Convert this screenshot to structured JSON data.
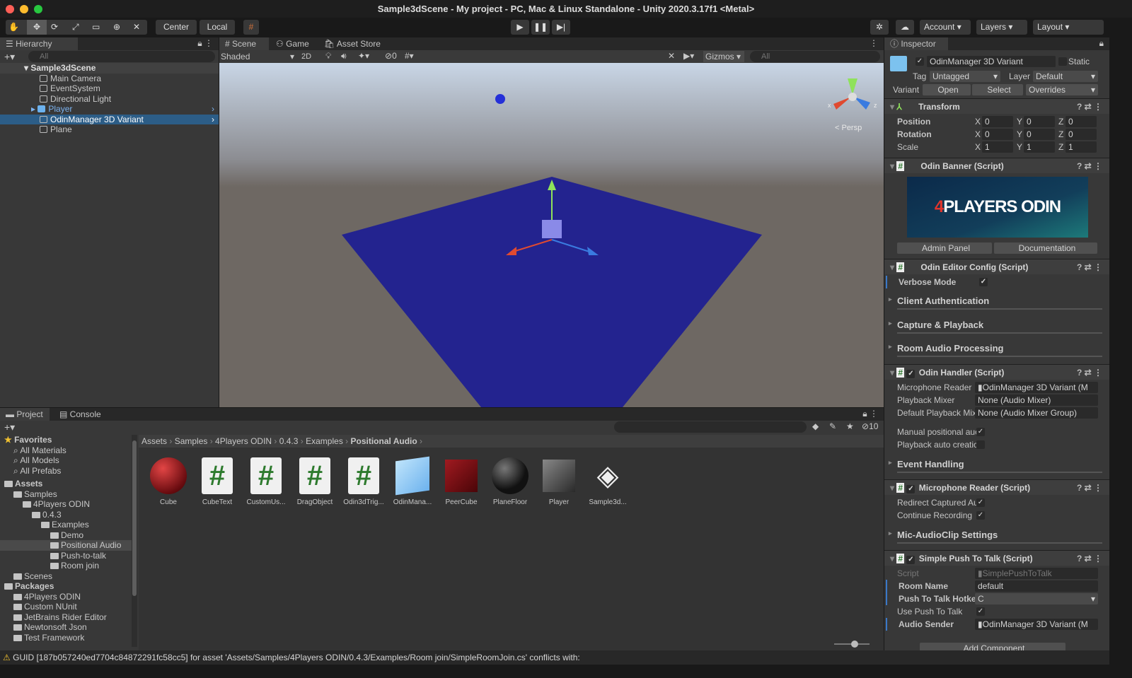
{
  "window": {
    "title": "Sample3dScene - My project - PC, Mac & Linux Standalone - Unity 2020.3.17f1 <Metal>"
  },
  "toolbar": {
    "tools": [
      "hand-tool",
      "move-tool",
      "rotate-tool",
      "scale-tool",
      "rect-tool",
      "transform-tool",
      "custom-tool"
    ],
    "pivot": "Center",
    "space": "Local",
    "account": "Account",
    "layers": "Layers",
    "layout": "Layout"
  },
  "hierarchy": {
    "tab": "Hierarchy",
    "search_placeholder": "All",
    "scene": "Sample3dScene",
    "items": [
      {
        "label": "Main Camera"
      },
      {
        "label": "EventSystem"
      },
      {
        "label": "Directional Light"
      },
      {
        "label": "Player"
      },
      {
        "label": "OdinManager 3D Variant"
      },
      {
        "label": "Plane"
      }
    ]
  },
  "scene": {
    "tabs": [
      "Scene",
      "Game",
      "Asset Store"
    ],
    "shading": "Shaded",
    "mode_2d": "2D",
    "hidden_count": "0",
    "gizmos": "Gizmos",
    "search_placeholder": "All",
    "persp": "< Persp",
    "axis_x": "x",
    "axis_z": "z",
    "colors": {
      "plane": "#23238f",
      "ground": "#6e6863",
      "sky": "#c9d6e6"
    }
  },
  "project": {
    "tabs": [
      "Project",
      "Console"
    ],
    "hidden_count": "10",
    "breadcrumb": [
      "Assets",
      "Samples",
      "4Players ODIN",
      "0.4.3",
      "Examples",
      "Positional Audio"
    ],
    "tree": [
      {
        "label": "Favorites",
        "depth": 0,
        "bold": true
      },
      {
        "label": "All Materials",
        "depth": 1
      },
      {
        "label": "All Models",
        "depth": 1
      },
      {
        "label": "All Prefabs",
        "depth": 1
      },
      {
        "label": "Assets",
        "depth": 0,
        "bold": true
      },
      {
        "label": "Samples",
        "depth": 1
      },
      {
        "label": "4Players ODIN",
        "depth": 2
      },
      {
        "label": "0.4.3",
        "depth": 3
      },
      {
        "label": "Examples",
        "depth": 4
      },
      {
        "label": "Demo",
        "depth": 5
      },
      {
        "label": "Positional Audio",
        "depth": 5
      },
      {
        "label": "Push-to-talk",
        "depth": 5
      },
      {
        "label": "Room join",
        "depth": 5
      },
      {
        "label": "Scenes",
        "depth": 1
      },
      {
        "label": "Packages",
        "depth": 0,
        "bold": true
      },
      {
        "label": "4Players ODIN",
        "depth": 1
      },
      {
        "label": "Custom NUnit",
        "depth": 1
      },
      {
        "label": "JetBrains Rider Editor",
        "depth": 1
      },
      {
        "label": "Newtonsoft Json",
        "depth": 1
      },
      {
        "label": "Test Framework",
        "depth": 1
      }
    ],
    "assets": [
      {
        "label": "Cube",
        "kind": "sphere-red"
      },
      {
        "label": "CubeText",
        "kind": "script"
      },
      {
        "label": "CustomUs...",
        "kind": "script"
      },
      {
        "label": "DragObject",
        "kind": "script"
      },
      {
        "label": "Odin3dTrig...",
        "kind": "script"
      },
      {
        "label": "OdinMana...",
        "kind": "prefab-variant"
      },
      {
        "label": "PeerCube",
        "kind": "cube-red"
      },
      {
        "label": "PlaneFloor",
        "kind": "sphere-black"
      },
      {
        "label": "Player",
        "kind": "cube-gray"
      },
      {
        "label": "Sample3d...",
        "kind": "unity-scene"
      }
    ]
  },
  "inspector": {
    "tab": "Inspector",
    "object_name": "OdinManager 3D Variant",
    "static": "Static",
    "tag_label": "Tag",
    "tag": "Untagged",
    "layer_label": "Layer",
    "layer": "Default",
    "variant_label": "Variant",
    "open": "Open",
    "select": "Select",
    "overrides": "Overrides",
    "transform": {
      "title": "Transform",
      "rows": [
        {
          "label": "Position",
          "x": "0",
          "y": "0",
          "z": "0"
        },
        {
          "label": "Rotation",
          "x": "0",
          "y": "0",
          "z": "0"
        },
        {
          "label": "Scale",
          "x": "1",
          "y": "1",
          "z": "1"
        }
      ]
    },
    "banner": {
      "title": "Odin Banner (Script)",
      "logo": "4PLAYERS ODIN",
      "admin": "Admin Panel",
      "docs": "Documentation"
    },
    "config": {
      "title": "Odin Editor Config (Script)",
      "verbose": "Verbose Mode",
      "sections": [
        "Client Authentication",
        "Capture & Playback",
        "Room Audio Processing"
      ]
    },
    "handler": {
      "title": "Odin Handler (Script)",
      "mic_label": "Microphone Reader",
      "mic": "OdinManager 3D Variant (M",
      "mixer_label": "Playback Mixer",
      "mixer": "None (Audio Mixer)",
      "group_label": "Default Playback Mix",
      "group": "None (Audio Mixer Group)",
      "manual": "Manual positional auc",
      "auto": "Playback auto creatic",
      "events": "Event Handling"
    },
    "mic": {
      "title": "Microphone Reader (Script)",
      "redirect": "Redirect Captured Au",
      "continue": "Continue Recording",
      "settings": "Mic-AudioClip Settings"
    },
    "ptt": {
      "title": "Simple Push To Talk (Script)",
      "script_label": "Script",
      "script": "SimplePushToTalk",
      "room_label": "Room Name",
      "room": "default",
      "hotkey_label": "Push To Talk Hotkey",
      "hotkey": "C",
      "use_label": "Use Push To Talk",
      "sender_label": "Audio Sender",
      "sender": "OdinManager 3D Variant (M"
    },
    "add_component": "Add Component"
  },
  "status": {
    "message": "GUID [187b057240ed7704c84872291fc58cc5] for asset 'Assets/Samples/4Players ODIN/0.4.3/Examples/Room join/SimpleRoomJoin.cs' conflicts with:"
  }
}
